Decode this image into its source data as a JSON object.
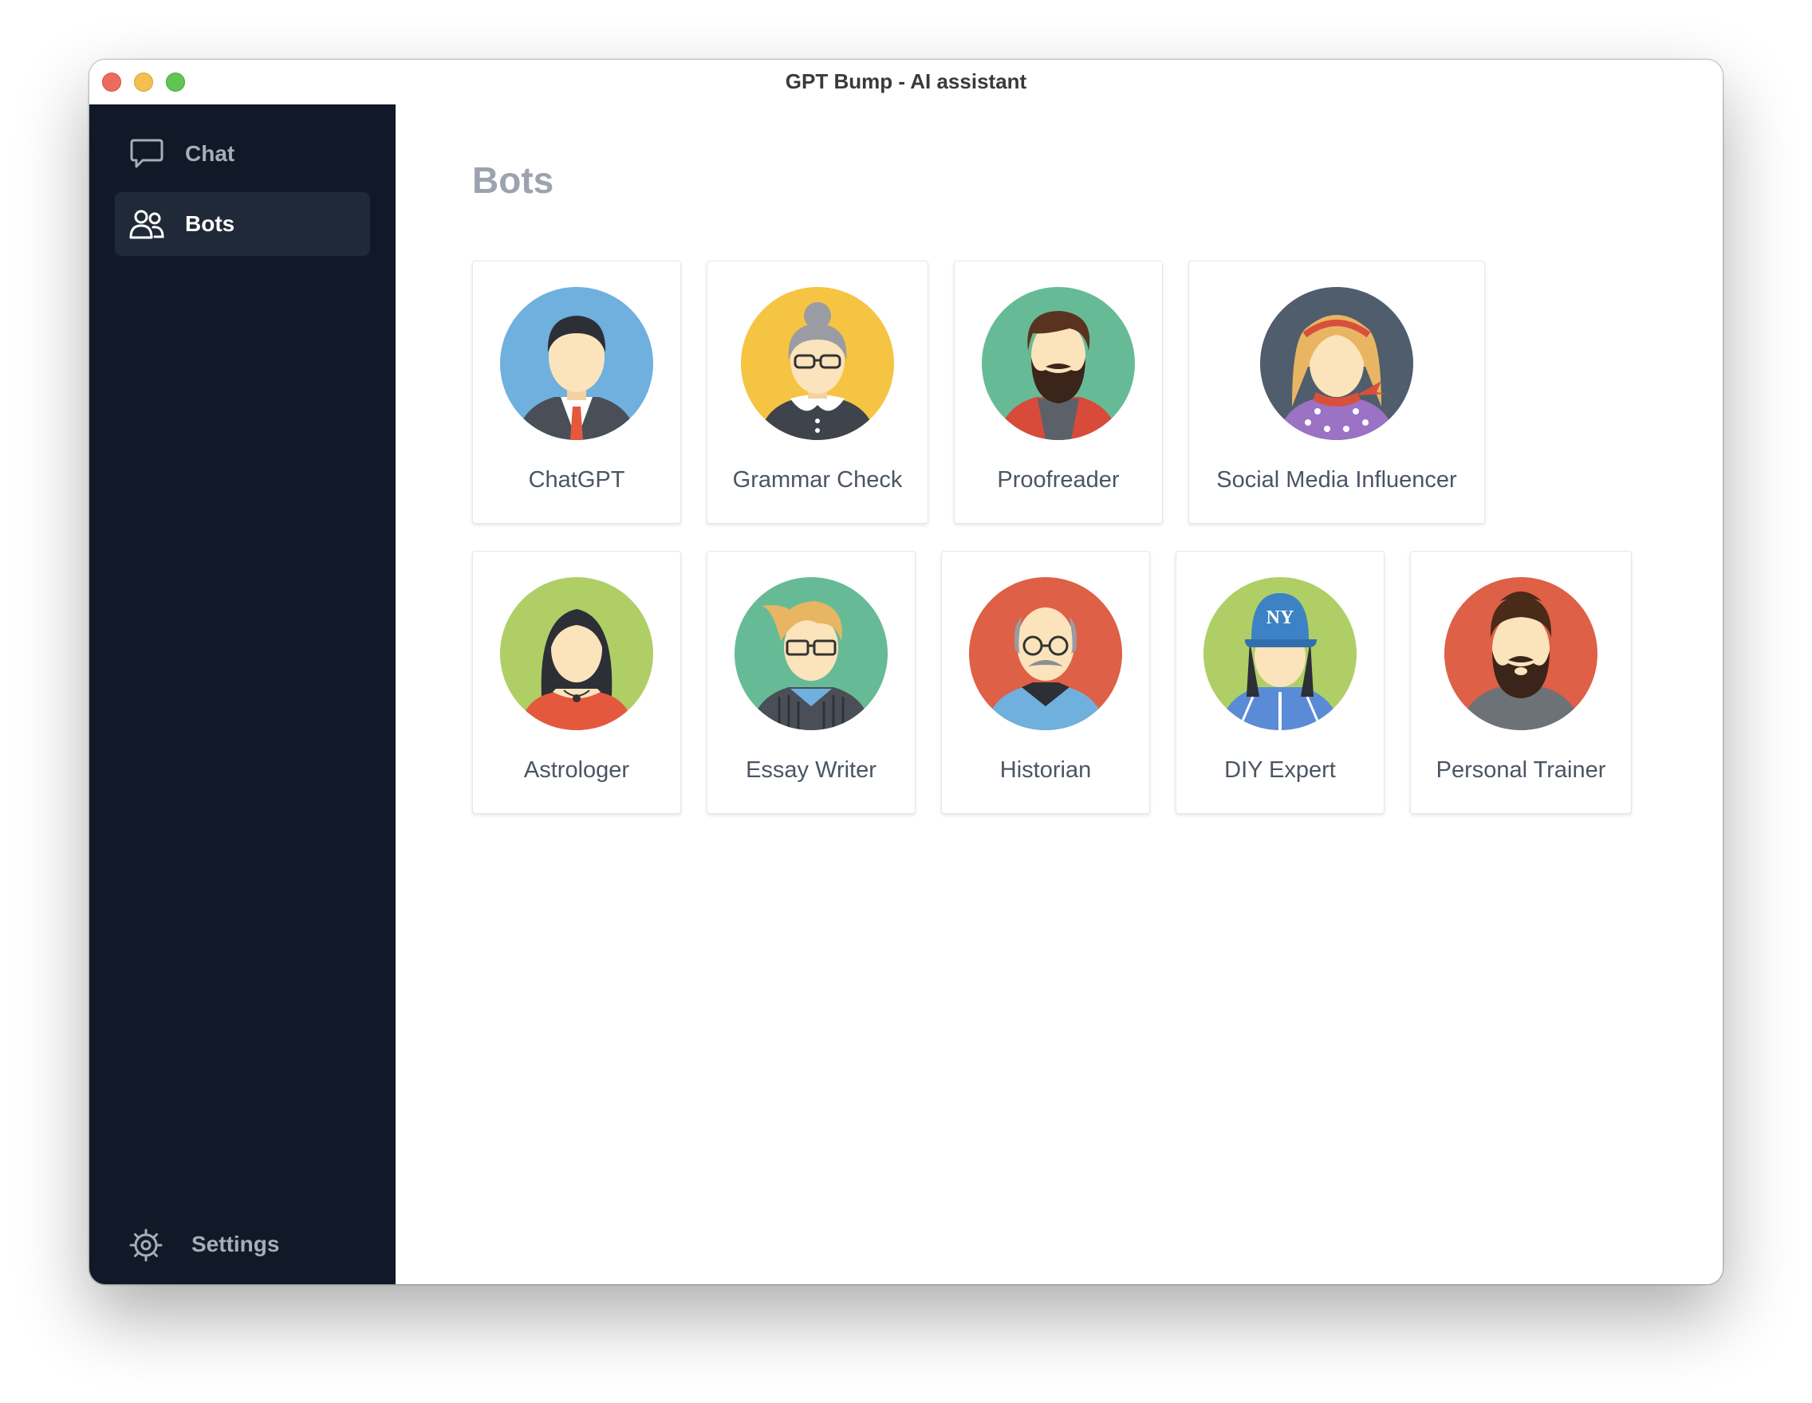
{
  "window": {
    "title": "GPT Bump - AI assistant"
  },
  "sidebar": {
    "items": [
      {
        "label": "Chat",
        "icon": "chat-bubble-icon",
        "active": false
      },
      {
        "label": "Bots",
        "icon": "users-icon",
        "active": true
      }
    ],
    "settings_label": "Settings",
    "settings_icon": "gear-icon"
  },
  "main": {
    "title": "Bots",
    "bots": [
      {
        "name": "ChatGPT",
        "avatar_bg": "#6fb0de"
      },
      {
        "name": "Grammar Check",
        "avatar_bg": "#f6c443"
      },
      {
        "name": "Proofreader",
        "avatar_bg": "#66bb96"
      },
      {
        "name": "Social Media Influencer",
        "avatar_bg": "#4f5d6d"
      },
      {
        "name": "Astrologer",
        "avatar_bg": "#afcf66"
      },
      {
        "name": "Essay Writer",
        "avatar_bg": "#66bb96"
      },
      {
        "name": "Historian",
        "avatar_bg": "#de6046"
      },
      {
        "name": "DIY Expert",
        "avatar_bg": "#afcf66",
        "cap_text": "NY"
      },
      {
        "name": "Personal Trainer",
        "avatar_bg": "#de6046"
      }
    ]
  },
  "colors": {
    "sidebar_bg": "#111827",
    "sidebar_active": "#1f2937",
    "title_gray": "#9ca3af",
    "skin": "#fbe3bc"
  }
}
